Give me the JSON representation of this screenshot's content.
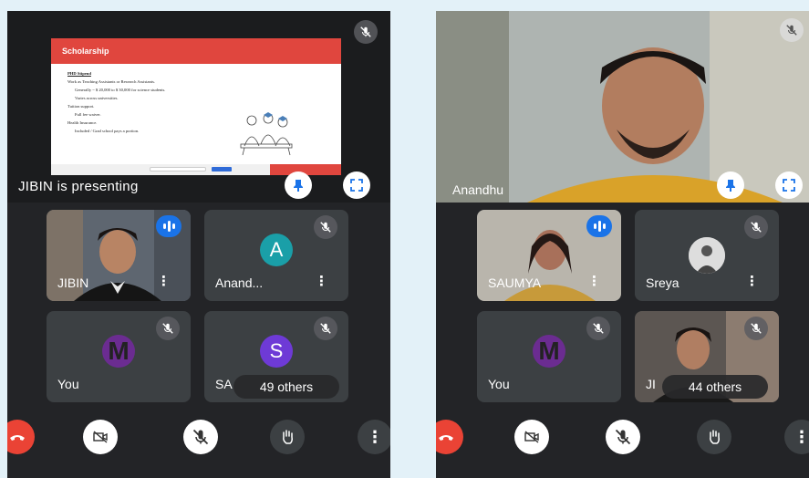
{
  "left": {
    "presentation": {
      "title": "Scholarship",
      "lines": [
        "PHD Stipend",
        "Work as Teaching Assistants or Research Assistants.",
        "Generally ~ $ 20,000 to $ 30,000 for science students.",
        "Varies across universities.",
        "Tuition support.",
        "Full fee waiver.",
        "Health Insurance.",
        "Included / Grad school pays a portion."
      ]
    },
    "presenting_label": "JIBIN is presenting",
    "tiles": [
      {
        "name": "JIBIN"
      },
      {
        "name": "Anand...",
        "initial": "A",
        "color": "#1a9fa8"
      },
      {
        "name": "You",
        "initial": "M"
      },
      {
        "name": "SA",
        "initial": "S",
        "color": "#6e3ad6"
      }
    ],
    "others": "49 others"
  },
  "right": {
    "main_name": "Anandhu",
    "tiles": [
      {
        "name": "SAUMYA"
      },
      {
        "name": "Sreya"
      },
      {
        "name": "You",
        "initial": "M"
      },
      {
        "name": "JI"
      }
    ],
    "others": "44 others"
  },
  "colors": {
    "end_call": "#ea4335",
    "speaking": "#1a73e8",
    "tile_bg": "#3c4043"
  },
  "icons": [
    "mic-off-icon",
    "pin-icon",
    "fullscreen-icon",
    "more-vert-icon",
    "end-call-icon",
    "camera-off-icon",
    "raise-hand-icon",
    "audio-level-icon"
  ]
}
